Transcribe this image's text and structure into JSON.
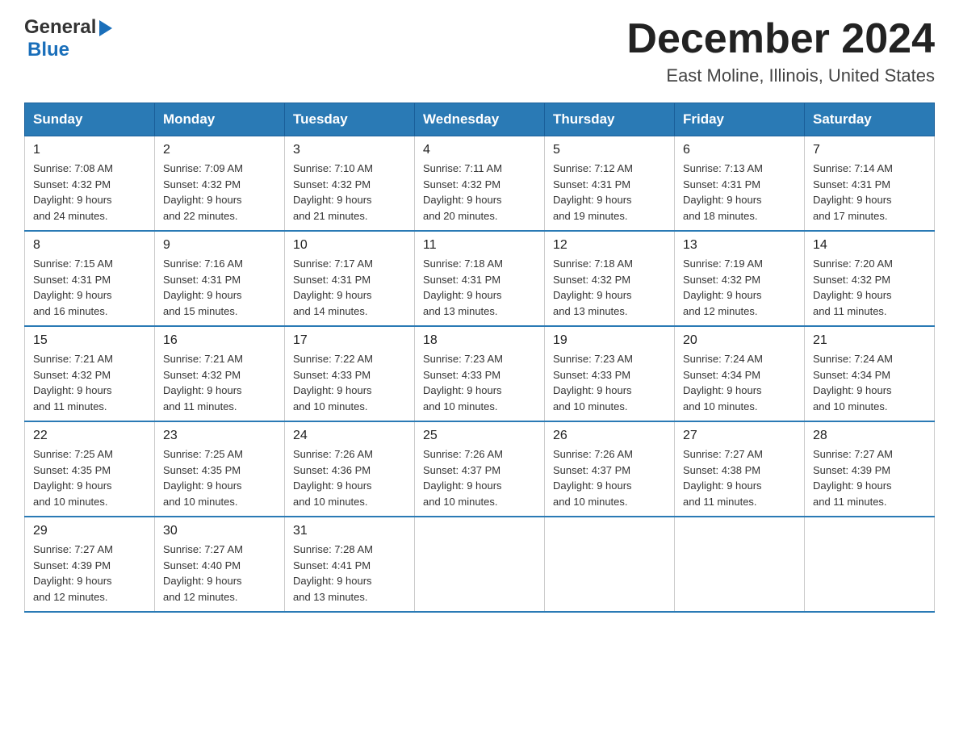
{
  "header": {
    "logo": {
      "general": "General",
      "blue": "Blue"
    },
    "title": "December 2024",
    "location": "East Moline, Illinois, United States"
  },
  "weekdays": [
    "Sunday",
    "Monday",
    "Tuesday",
    "Wednesday",
    "Thursday",
    "Friday",
    "Saturday"
  ],
  "weeks": [
    [
      {
        "day": "1",
        "sunrise": "7:08 AM",
        "sunset": "4:32 PM",
        "daylight": "9 hours and 24 minutes."
      },
      {
        "day": "2",
        "sunrise": "7:09 AM",
        "sunset": "4:32 PM",
        "daylight": "9 hours and 22 minutes."
      },
      {
        "day": "3",
        "sunrise": "7:10 AM",
        "sunset": "4:32 PM",
        "daylight": "9 hours and 21 minutes."
      },
      {
        "day": "4",
        "sunrise": "7:11 AM",
        "sunset": "4:32 PM",
        "daylight": "9 hours and 20 minutes."
      },
      {
        "day": "5",
        "sunrise": "7:12 AM",
        "sunset": "4:31 PM",
        "daylight": "9 hours and 19 minutes."
      },
      {
        "day": "6",
        "sunrise": "7:13 AM",
        "sunset": "4:31 PM",
        "daylight": "9 hours and 18 minutes."
      },
      {
        "day": "7",
        "sunrise": "7:14 AM",
        "sunset": "4:31 PM",
        "daylight": "9 hours and 17 minutes."
      }
    ],
    [
      {
        "day": "8",
        "sunrise": "7:15 AM",
        "sunset": "4:31 PM",
        "daylight": "9 hours and 16 minutes."
      },
      {
        "day": "9",
        "sunrise": "7:16 AM",
        "sunset": "4:31 PM",
        "daylight": "9 hours and 15 minutes."
      },
      {
        "day": "10",
        "sunrise": "7:17 AM",
        "sunset": "4:31 PM",
        "daylight": "9 hours and 14 minutes."
      },
      {
        "day": "11",
        "sunrise": "7:18 AM",
        "sunset": "4:31 PM",
        "daylight": "9 hours and 13 minutes."
      },
      {
        "day": "12",
        "sunrise": "7:18 AM",
        "sunset": "4:32 PM",
        "daylight": "9 hours and 13 minutes."
      },
      {
        "day": "13",
        "sunrise": "7:19 AM",
        "sunset": "4:32 PM",
        "daylight": "9 hours and 12 minutes."
      },
      {
        "day": "14",
        "sunrise": "7:20 AM",
        "sunset": "4:32 PM",
        "daylight": "9 hours and 11 minutes."
      }
    ],
    [
      {
        "day": "15",
        "sunrise": "7:21 AM",
        "sunset": "4:32 PM",
        "daylight": "9 hours and 11 minutes."
      },
      {
        "day": "16",
        "sunrise": "7:21 AM",
        "sunset": "4:32 PM",
        "daylight": "9 hours and 11 minutes."
      },
      {
        "day": "17",
        "sunrise": "7:22 AM",
        "sunset": "4:33 PM",
        "daylight": "9 hours and 10 minutes."
      },
      {
        "day": "18",
        "sunrise": "7:23 AM",
        "sunset": "4:33 PM",
        "daylight": "9 hours and 10 minutes."
      },
      {
        "day": "19",
        "sunrise": "7:23 AM",
        "sunset": "4:33 PM",
        "daylight": "9 hours and 10 minutes."
      },
      {
        "day": "20",
        "sunrise": "7:24 AM",
        "sunset": "4:34 PM",
        "daylight": "9 hours and 10 minutes."
      },
      {
        "day": "21",
        "sunrise": "7:24 AM",
        "sunset": "4:34 PM",
        "daylight": "9 hours and 10 minutes."
      }
    ],
    [
      {
        "day": "22",
        "sunrise": "7:25 AM",
        "sunset": "4:35 PM",
        "daylight": "9 hours and 10 minutes."
      },
      {
        "day": "23",
        "sunrise": "7:25 AM",
        "sunset": "4:35 PM",
        "daylight": "9 hours and 10 minutes."
      },
      {
        "day": "24",
        "sunrise": "7:26 AM",
        "sunset": "4:36 PM",
        "daylight": "9 hours and 10 minutes."
      },
      {
        "day": "25",
        "sunrise": "7:26 AM",
        "sunset": "4:37 PM",
        "daylight": "9 hours and 10 minutes."
      },
      {
        "day": "26",
        "sunrise": "7:26 AM",
        "sunset": "4:37 PM",
        "daylight": "9 hours and 10 minutes."
      },
      {
        "day": "27",
        "sunrise": "7:27 AM",
        "sunset": "4:38 PM",
        "daylight": "9 hours and 11 minutes."
      },
      {
        "day": "28",
        "sunrise": "7:27 AM",
        "sunset": "4:39 PM",
        "daylight": "9 hours and 11 minutes."
      }
    ],
    [
      {
        "day": "29",
        "sunrise": "7:27 AM",
        "sunset": "4:39 PM",
        "daylight": "9 hours and 12 minutes."
      },
      {
        "day": "30",
        "sunrise": "7:27 AM",
        "sunset": "4:40 PM",
        "daylight": "9 hours and 12 minutes."
      },
      {
        "day": "31",
        "sunrise": "7:28 AM",
        "sunset": "4:41 PM",
        "daylight": "9 hours and 13 minutes."
      },
      null,
      null,
      null,
      null
    ]
  ]
}
